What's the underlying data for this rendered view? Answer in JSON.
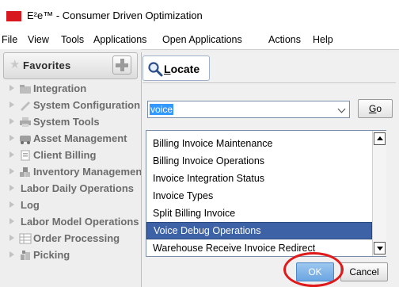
{
  "window": {
    "title": "E²e™ - Consumer Driven Optimization",
    "accent_color": "#d7191f"
  },
  "menu": [
    "File",
    "View",
    "Tools",
    "Applications",
    "Open Applications",
    "Actions",
    "Help"
  ],
  "favorites": {
    "label": "Favorites",
    "items": [
      {
        "label": "Integration",
        "icon": "folder-icon"
      },
      {
        "label": "System Configuration",
        "icon": "wrench-icon"
      },
      {
        "label": "System Tools",
        "icon": "printer-icon"
      },
      {
        "label": "Asset Management",
        "icon": "vehicle-icon"
      },
      {
        "label": "Client Billing",
        "icon": "document-icon"
      },
      {
        "label": "Inventory Management",
        "icon": "inventory-icon"
      },
      {
        "label": "Labor Daily Operations",
        "icon": ""
      },
      {
        "label": "Log",
        "icon": ""
      },
      {
        "label": "Labor Model Operations",
        "icon": ""
      },
      {
        "label": "Order Processing",
        "icon": "grid-icon"
      },
      {
        "label": "Picking",
        "icon": "picking-icon"
      }
    ]
  },
  "locate": {
    "title_prefix": "L",
    "title_rest": "ocate",
    "search_value": "voice",
    "go_prefix": "G",
    "go_rest": "o",
    "results": [
      "Billing Invoice Maintenance",
      "Billing Invoice Operations",
      "Invoice Integration Status",
      "Invoice Types",
      "Split Billing Invoice",
      "Voice Debug Operations",
      "Warehouse Receive Invoice Redirect"
    ],
    "selected_index": 5,
    "ok_label": "OK",
    "cancel_label": "Cancel",
    "highlight_color": "#e01a1a"
  }
}
